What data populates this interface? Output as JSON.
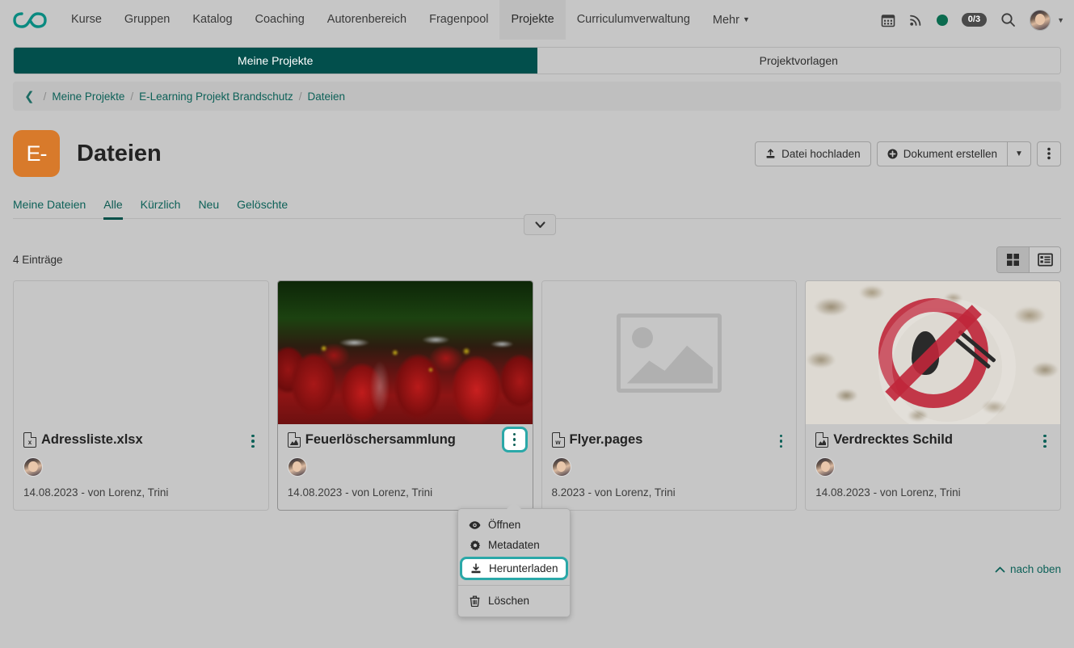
{
  "topnav": {
    "logo_name": "infinity-logo",
    "items": [
      {
        "label": "Kurse",
        "active": false
      },
      {
        "label": "Gruppen",
        "active": false
      },
      {
        "label": "Katalog",
        "active": false
      },
      {
        "label": "Coaching",
        "active": false
      },
      {
        "label": "Autorenbereich",
        "active": false
      },
      {
        "label": "Fragenpool",
        "active": false
      },
      {
        "label": "Projekte",
        "active": true
      },
      {
        "label": "Curriculumverwaltung",
        "active": false
      },
      {
        "label": "Mehr",
        "active": false,
        "caret": true
      }
    ],
    "right": {
      "calendar_icon": "calendar-icon",
      "feed_icon": "rss-icon",
      "status_dot": "status-dot",
      "badge": "0/3",
      "search_icon": "search-icon",
      "avatar": "user-avatar",
      "caret": "chevron-down-icon"
    }
  },
  "project_tabs": [
    {
      "label": "Meine Projekte",
      "active": true
    },
    {
      "label": "Projektvorlagen",
      "active": false
    }
  ],
  "breadcrumb": {
    "back_icon": "chevron-left-icon",
    "items": [
      "Meine Projekte",
      "E-Learning Projekt Brandschutz",
      "Dateien"
    ],
    "separator": "/"
  },
  "header": {
    "badge_text": "E-",
    "title": "Dateien",
    "actions": {
      "upload_label": "Datei hochladen",
      "create_label": "Dokument erstellen",
      "caret_icon": "chevron-down-icon",
      "kebab_icon": "more-vertical-icon"
    }
  },
  "filter_tabs": [
    {
      "label": "Meine Dateien",
      "active": false
    },
    {
      "label": "Alle",
      "active": true
    },
    {
      "label": "Kürzlich",
      "active": false
    },
    {
      "label": "Neu",
      "active": false
    },
    {
      "label": "Gelöschte",
      "active": false
    }
  ],
  "collapse_toggle": {
    "icon": "chevron-down-icon"
  },
  "list": {
    "entry_count": "4 Einträge",
    "view_grid_icon": "grid-view-icon",
    "view_list_icon": "list-view-icon",
    "active_view": "grid"
  },
  "cards": [
    {
      "title": "Adressliste.xlsx",
      "file_type": "xlsx",
      "icon_glyph": "x",
      "thumb": "none",
      "meta": "14.08.2023 - von Lorenz, Trini",
      "hover": false,
      "menu_open": false
    },
    {
      "title": "Feuerlöschersammlung",
      "file_type": "image",
      "icon_glyph": "image",
      "thumb": "fire-extinguishers-photo",
      "meta": "14.08.2023 - von Lorenz, Trini",
      "hover": true,
      "menu_open": true
    },
    {
      "title": "Flyer.pages",
      "file_type": "pages",
      "icon_glyph": "w",
      "thumb": "image-placeholder",
      "meta": "8.2023 - von Lorenz, Trini",
      "hover": false,
      "menu_open": false
    },
    {
      "title": "Verdrecktes Schild",
      "file_type": "image",
      "icon_glyph": "image",
      "thumb": "no-flame-sign-photo",
      "meta": "14.08.2023 - von Lorenz, Trini",
      "hover": false,
      "menu_open": false
    }
  ],
  "context_menu": {
    "items": [
      {
        "label": "Öffnen",
        "icon": "eye-icon",
        "selected": false
      },
      {
        "label": "Metadaten",
        "icon": "gear-icon",
        "selected": false
      },
      {
        "label": "Herunterladen",
        "icon": "download-icon",
        "selected": true
      },
      {
        "label": "Löschen",
        "icon": "trash-icon",
        "selected": false,
        "separator_before": true
      }
    ]
  },
  "footer": {
    "to_top_label": "nach oben",
    "to_top_icon": "chevron-up-icon"
  },
  "colors": {
    "brand_teal": "#0d6158",
    "tab_active_bg": "#024f4c",
    "highlight_ring": "#2aa8a8",
    "badge_orange": "#d87a2b",
    "page_bg": "#c6c6c6"
  }
}
